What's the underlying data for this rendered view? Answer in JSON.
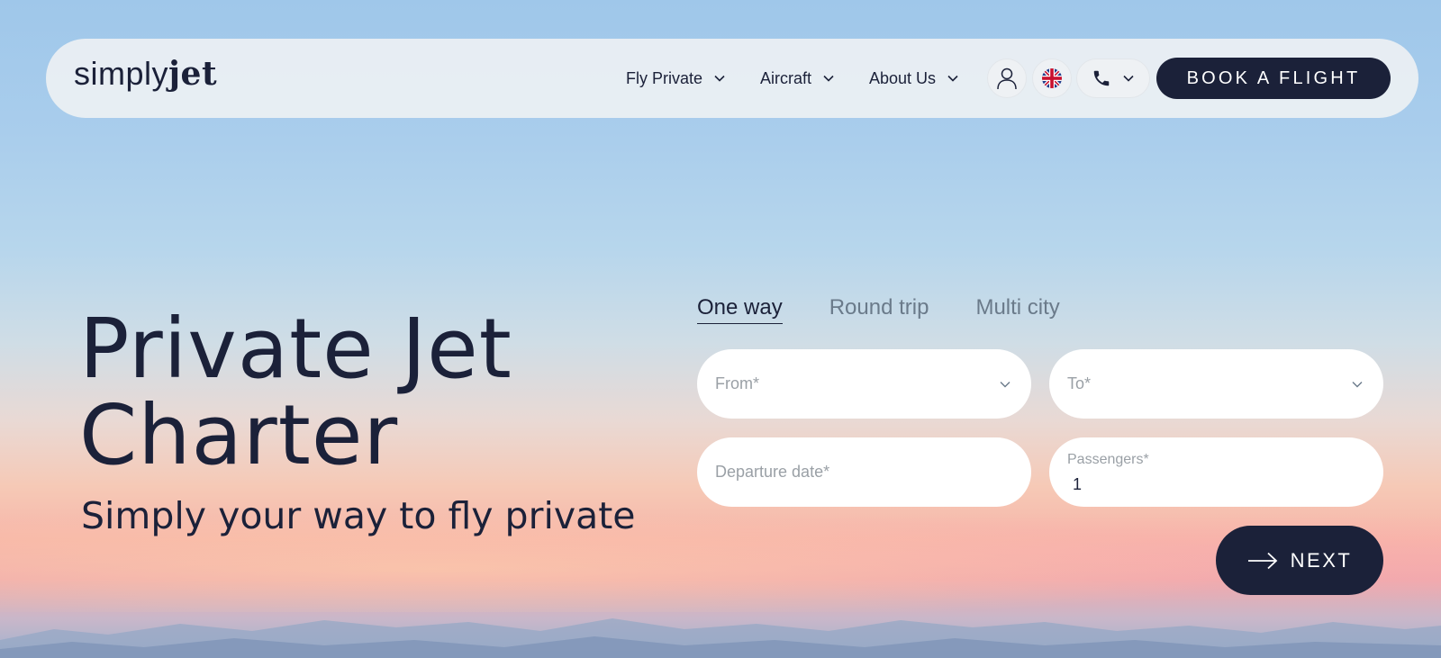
{
  "logo": {
    "light": "simply",
    "bold": "jet"
  },
  "nav": {
    "items": [
      {
        "label": "Fly Private"
      },
      {
        "label": "Aircraft"
      },
      {
        "label": "About Us"
      }
    ],
    "book_label": "BOOK A FLIGHT"
  },
  "hero": {
    "title_line1": "Private Jet",
    "title_line2": "Charter",
    "subtitle": "Simply your way to fly private"
  },
  "booking": {
    "tabs": [
      {
        "label": "One way",
        "active": true
      },
      {
        "label": "Round trip",
        "active": false
      },
      {
        "label": "Multi city",
        "active": false
      }
    ],
    "from_placeholder": "From*",
    "to_placeholder": "To*",
    "date_placeholder": "Departure date*",
    "passengers_label": "Passengers*",
    "passengers_value": "1",
    "next_label": "NEXT"
  },
  "colors": {
    "navy": "#1b2139",
    "white": "#ffffff",
    "muted": "#6a7a8a"
  },
  "icons": [
    "chevron-down-icon",
    "user-icon",
    "uk-flag-icon",
    "phone-icon",
    "arrow-right-icon"
  ]
}
